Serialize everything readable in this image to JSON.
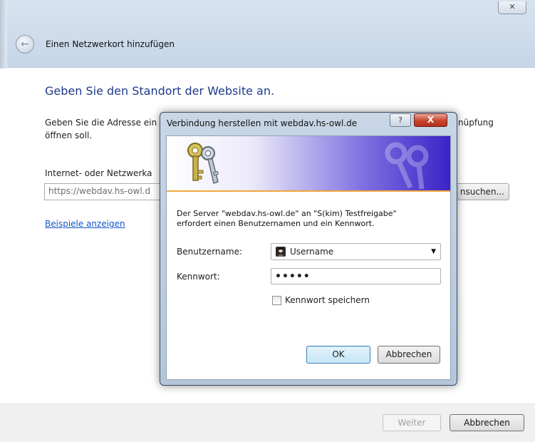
{
  "wizard": {
    "close_glyph": "✕",
    "back_glyph": "←",
    "title": "Einen Netzwerkort hinzufügen",
    "heading": "Geben Sie den Standort der Website an.",
    "description_line1": "Geben Sie die Adresse ein",
    "description_line1_end": "nüpfung",
    "description_line2": "öffnen soll.",
    "address_label": "Internet- oder Netzwerka",
    "address_value": "https://webdav.hs-owl.d",
    "browse_label": "nsuchen...",
    "examples_link": "Beispiele anzeigen",
    "next_button": "Weiter",
    "cancel_button": "Abbrechen"
  },
  "dialog": {
    "title": "Verbindung herstellen mit webdav.hs-owl.de",
    "help_glyph": "?",
    "close_glyph": "X",
    "message_line1": "Der Server \"webdav.hs-owl.de\" an \"S(kim) Testfreigabe\"",
    "message_line2": "erfordert einen Benutzernamen und ein Kennwort.",
    "username_label": "Benutzername:",
    "username_value": "Username",
    "password_label": "Kennwort:",
    "password_value": "•••••",
    "remember_label": "Kennwort speichern",
    "remember_checked": false,
    "ok_button": "OK",
    "cancel_button": "Abbrechen"
  },
  "colors": {
    "heading": "#1e3a8a",
    "link": "#1155cc",
    "banner_accent": "#3b23c6",
    "banner_stripe": "#f0a640"
  }
}
